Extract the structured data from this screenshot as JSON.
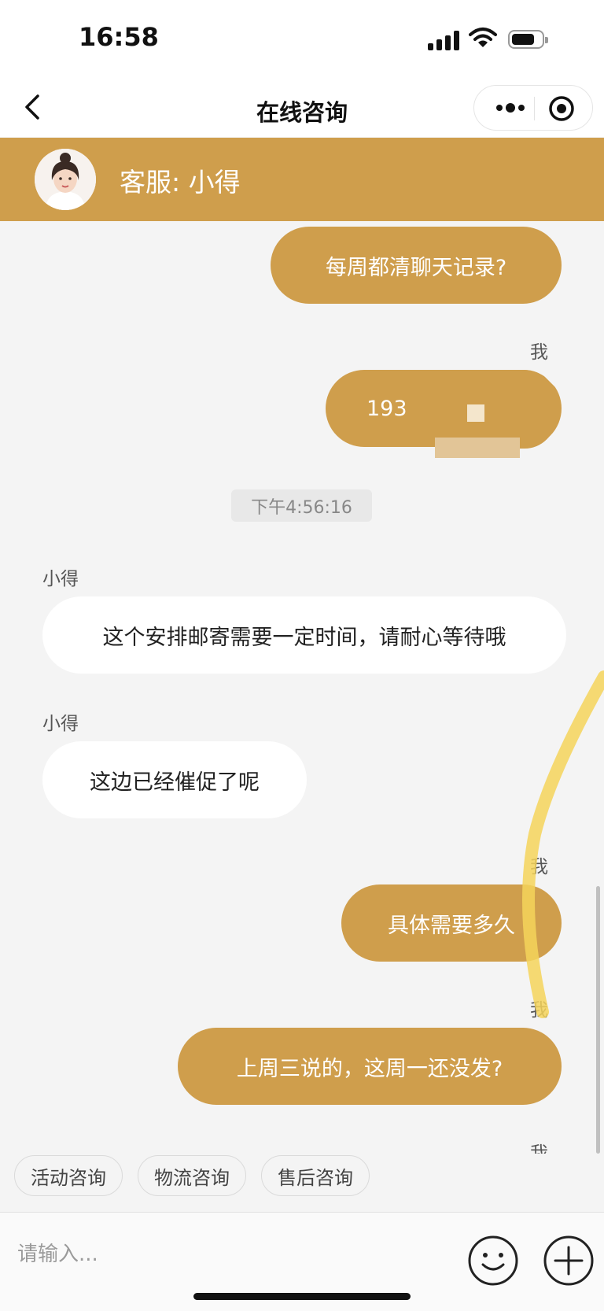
{
  "status_bar": {
    "time": "16:58"
  },
  "navbar": {
    "title": "在线咨询"
  },
  "agent": {
    "name": "客服: 小得"
  },
  "messages": {
    "m1": "每周都清聊天记录?",
    "sender_me": "我",
    "m2": "193",
    "timestamp": "下午4:56:16",
    "sender_agent": "小得",
    "m3": "这个安排邮寄需要一定时间，请耐心等待哦",
    "m4": "这边已经催促了呢",
    "m5": "具体需要多久",
    "m6": "上周三说的，这周一还没发?"
  },
  "quick_replies": [
    "活动咨询",
    "物流咨询",
    "售后咨询"
  ],
  "input": {
    "placeholder": "请输入..."
  },
  "colors": {
    "accent": "#cf9e4c",
    "highlight_stroke": "#f5d35a"
  }
}
